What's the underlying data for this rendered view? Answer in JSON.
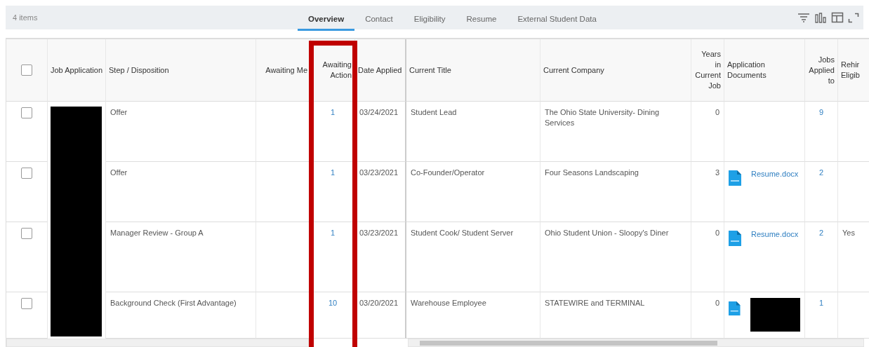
{
  "toolbar": {
    "item_count": "4 items",
    "tabs": [
      {
        "label": "Overview",
        "selected": true
      },
      {
        "label": "Contact",
        "selected": false
      },
      {
        "label": "Eligibility",
        "selected": false
      },
      {
        "label": "Resume",
        "selected": false
      },
      {
        "label": "External Student Data",
        "selected": false
      }
    ]
  },
  "table": {
    "select_all": {
      "checked": false
    },
    "columns": [
      {
        "label": "Job Application",
        "kind": "redacted"
      },
      {
        "label": "Step / Disposition",
        "kind": "text"
      },
      {
        "label": "Awaiting Me",
        "kind": "number"
      },
      {
        "label": "Awaiting Action",
        "kind": "link",
        "highlighted": true
      },
      {
        "label": "Date Applied",
        "kind": "text"
      },
      {
        "label": "Current Title",
        "kind": "text"
      },
      {
        "label": "Current Company",
        "kind": "text"
      },
      {
        "label": "Years in Current Job",
        "kind": "number"
      },
      {
        "label": "Application Documents",
        "kind": "document"
      },
      {
        "label": "Jobs Applied to",
        "kind": "link"
      },
      {
        "label": "Rehir Eligib",
        "kind": "text"
      }
    ],
    "rows": [
      {
        "checked": false,
        "cells": [
          null,
          "Offer",
          null,
          "1",
          "03/24/2021",
          "Student Lead",
          "The Ohio State University- Dining Services",
          "0",
          null,
          "9",
          null
        ]
      },
      {
        "checked": false,
        "cells": [
          null,
          "Offer",
          null,
          "1",
          "03/23/2021",
          "Co-Founder/Operator",
          "Four Seasons Landscaping",
          "3",
          {
            "name": "Resume.docx"
          },
          "2",
          null
        ]
      },
      {
        "checked": false,
        "cells": [
          null,
          "Manager Review - Group A",
          null,
          "1",
          "03/23/2021",
          "Student Cook/ Student Server",
          "Ohio Student Union - Sloopy's Diner",
          "0",
          {
            "name": "Resume.docx"
          },
          "2",
          "Yes"
        ]
      },
      {
        "checked": false,
        "cells": [
          null,
          "Background Check (First Advantage)",
          null,
          "10",
          "03/20/2021",
          "Warehouse Employee",
          "STATEWIRE and TERMINAL",
          "0",
          {
            "redacted": true
          },
          "1",
          null
        ]
      }
    ]
  }
}
